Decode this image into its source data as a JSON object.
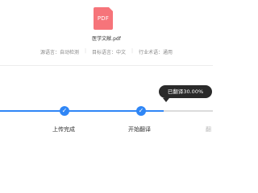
{
  "file": {
    "icon_label": "PDF",
    "icon_name": "pdf-file-icon",
    "name": "医学文献.pdf"
  },
  "meta": {
    "source_language": "源语言：自动检测",
    "target_language": "目标语言：中文",
    "industry_term": "行业术语：通用",
    "separator": "|"
  },
  "progress": {
    "tooltip": "已翻译30.00%",
    "percent": 30.0,
    "steps": [
      {
        "label": "上传完成",
        "state": "done",
        "icon": "check-icon",
        "glyph": "✓"
      },
      {
        "label": "开始翻译",
        "state": "done",
        "icon": "check-icon",
        "glyph": "✓"
      },
      {
        "label": "翻",
        "state": "pending"
      }
    ]
  },
  "colors": {
    "accent": "#2f86f6",
    "pdf_badge": "#f6747a",
    "tooltip_bg": "#2a2a2a",
    "track_inactive": "#dcdcdc"
  }
}
